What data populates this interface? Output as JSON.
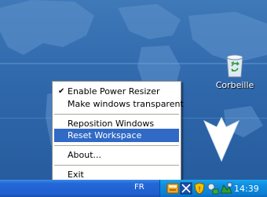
{
  "desktop": {
    "recycle_bin_label": "Corbeille"
  },
  "context_menu": {
    "items": [
      {
        "label": "Enable Power Resizer",
        "checked": true
      },
      {
        "label": "Make windows transparent"
      },
      {
        "label": "Reposition Windows"
      },
      {
        "label": "Reset Workspace",
        "highlighted": true
      },
      {
        "label": "About..."
      },
      {
        "label": "Exit"
      }
    ]
  },
  "taskbar": {
    "language": "FR",
    "clock": "14:39",
    "tray_icons": [
      "power-resizer-icon",
      "network-icon",
      "security-shield-icon",
      "safely-remove-hardware-icon",
      "display-settings-icon"
    ]
  },
  "colors": {
    "menu_highlight": "#316ac5",
    "desktop": "#2f67ab",
    "taskbar": "#1f5fcf",
    "tray": "#0f8ee0"
  }
}
